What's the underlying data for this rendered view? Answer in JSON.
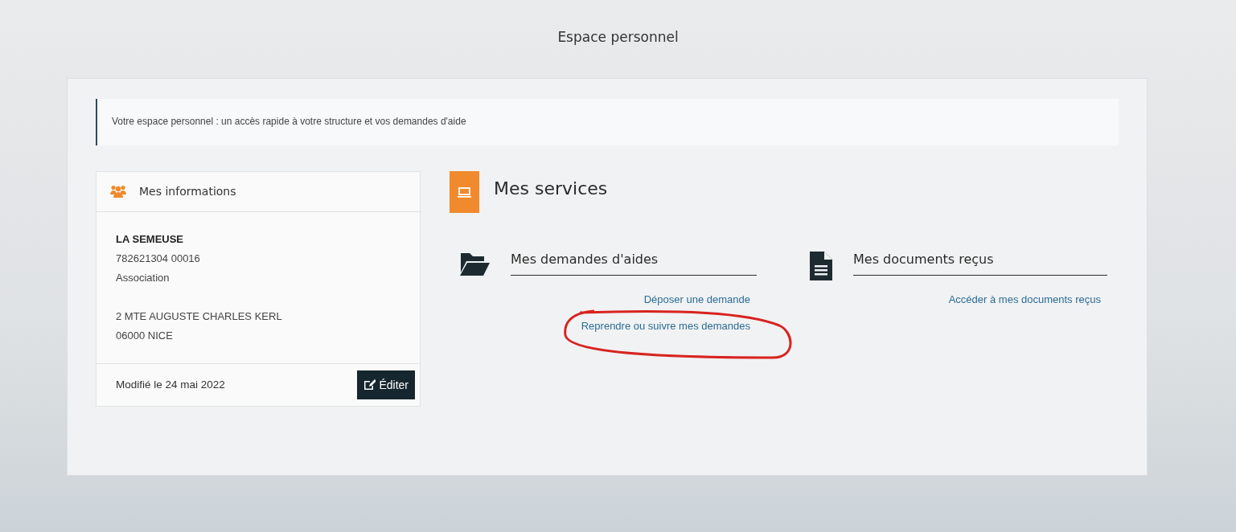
{
  "page_title": "Espace personnel",
  "banner": "Votre espace personnel : un accès rapide à votre structure et vos demandes d'aide",
  "info_card": {
    "title": "Mes informations",
    "name": "LA SEMEUSE",
    "siret": "782621304 00016",
    "type": "Association",
    "address": [
      "2 MTE AUGUSTE CHARLES KERL",
      "06000 NICE"
    ],
    "modified": "Modifié le 24 mai 2022",
    "edit_button": "Éditer"
  },
  "services": {
    "title": "Mes services",
    "items": [
      {
        "kind": "folder",
        "title": "Mes demandes d'aides",
        "links": [
          "Déposer une demande",
          "Reprendre ou suivre mes demandes"
        ]
      },
      {
        "kind": "document",
        "title": "Mes documents reçus",
        "links": [
          "Accéder à mes documents reçus"
        ]
      }
    ]
  }
}
